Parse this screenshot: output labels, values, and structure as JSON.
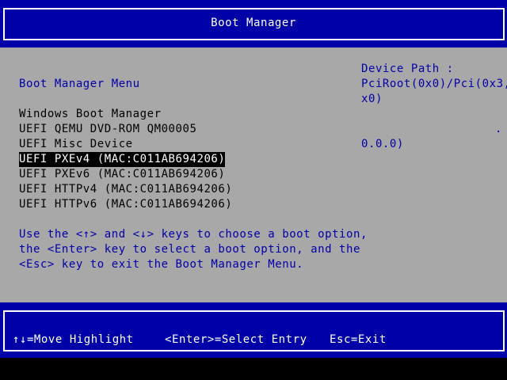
{
  "header": {
    "title": "Boot Manager"
  },
  "main": {
    "menu_title": "Boot Manager Menu",
    "boot_options": [
      {
        "label": "Windows Boot Manager",
        "selected": false
      },
      {
        "label": "UEFI QEMU DVD-ROM QM00005",
        "selected": false
      },
      {
        "label": "UEFI Misc Device",
        "selected": false
      },
      {
        "label": "UEFI PXEv4 (MAC:C011AB694206)",
        "selected": true
      },
      {
        "label": "UEFI PXEv6 (MAC:C011AB694206)",
        "selected": false
      },
      {
        "label": "UEFI HTTPv4 (MAC:C011AB694206)",
        "selected": false
      },
      {
        "label": "UEFI HTTPv6 (MAC:C011AB694206)",
        "selected": false
      }
    ],
    "help_text": [
      "Use the <↑> and <↓> keys to choose a boot option,",
      "the <Enter> key to select a boot option, and the",
      "<Esc> key to exit the Boot Manager Menu."
    ]
  },
  "device_path": {
    "label": "Device Path :",
    "lines": [
      "PciRoot(0x0)/Pci(0x3,0",
      "x0)",
      ".",
      "0.0.0)"
    ]
  },
  "footer": {
    "move_hint": "↑↓=Move Highlight",
    "select_hint": "<Enter>=Select Entry",
    "exit_hint": "Esc=Exit"
  },
  "colors": {
    "bios_blue": "#0000a8",
    "bios_gray": "#a8a8a8",
    "text_white": "#ffffff",
    "text_black": "#000000"
  }
}
